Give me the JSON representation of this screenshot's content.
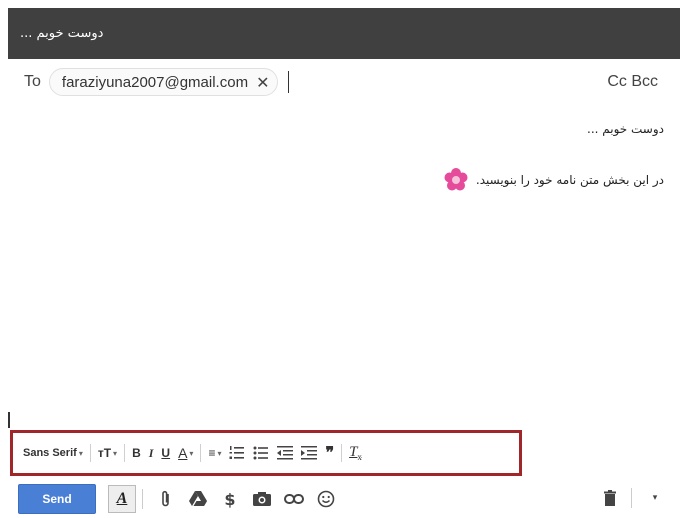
{
  "window": {
    "title": "دوست خوبم ..."
  },
  "recipients": {
    "to_label": "To",
    "chips": [
      {
        "email": "faraziyuna2007@gmail.com"
      }
    ],
    "cc_bcc_label": "Cc Bcc"
  },
  "message": {
    "line1": "دوست خوبم ...",
    "line2": "در این بخش متن نامه خود را بنویسید."
  },
  "format_toolbar": {
    "font_label": "Sans Serif",
    "tools": [
      "font-size",
      "bold",
      "italic",
      "underline",
      "text-color",
      "align",
      "numbered-list",
      "bulleted-list",
      "indent-less",
      "indent-more",
      "quote",
      "remove-formatting"
    ]
  },
  "bottom_toolbar": {
    "send_label": "Send"
  },
  "colors": {
    "titlebar": "#404040",
    "send": "#4a7fd6",
    "highlight_box": "#a0262a",
    "flower": "#e64a9a"
  }
}
